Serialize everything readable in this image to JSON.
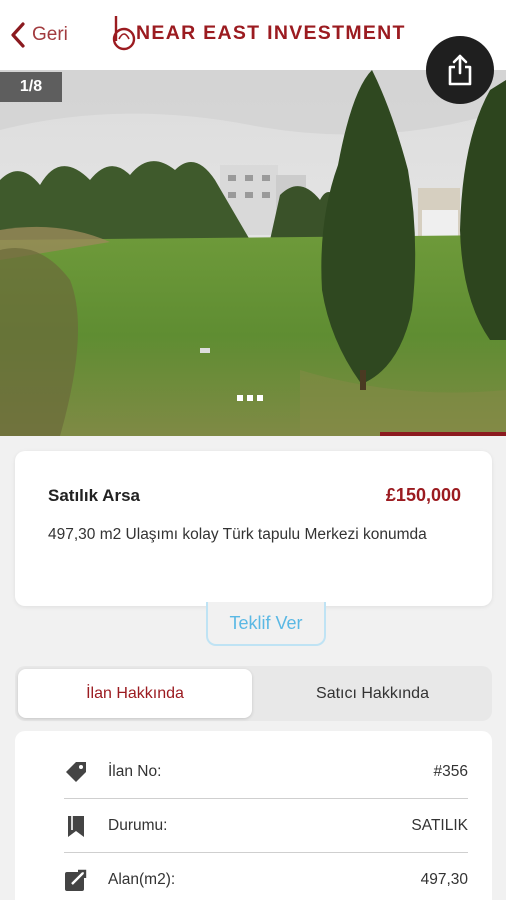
{
  "header": {
    "back_label": "Geri",
    "logo_text": "NEAR EAST INVESTMENT",
    "brand_color": "#9b1b20"
  },
  "gallery": {
    "counter": "1/8",
    "current_index": 1,
    "total": 8
  },
  "listing": {
    "title": "Satılık Arsa",
    "price": "£150,000",
    "description": "497,30 m2 Ulaşımı kolay Türk tapulu Merkezi konumda"
  },
  "actions": {
    "offer_label": "Teklif Ver",
    "share_icon": "share-icon"
  },
  "tabs": [
    {
      "label": "İlan Hakkında",
      "active": true
    },
    {
      "label": "Satıcı Hakkında",
      "active": false
    }
  ],
  "details": [
    {
      "icon": "tag-icon",
      "label": "İlan No:",
      "value": "#356"
    },
    {
      "icon": "bookmark-icon",
      "label": "Durumu:",
      "value": "SATILIK"
    },
    {
      "icon": "area-icon",
      "label": "Alan(m2):",
      "value": "497,30"
    }
  ]
}
